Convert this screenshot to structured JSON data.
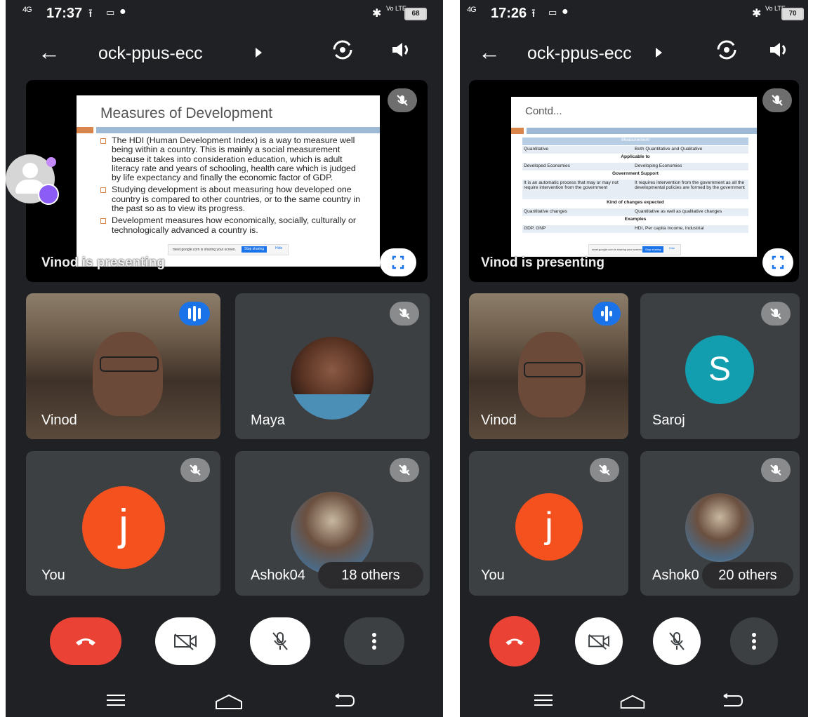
{
  "colors": {
    "background": "#202124",
    "tile": "#3c4043",
    "end_call": "#ea4335",
    "avatar_j": "#f4511e",
    "avatar_s": "#129eaf",
    "voice_indicator": "#1a73e8"
  },
  "left": {
    "status": {
      "network": "4G",
      "time": "17:37",
      "battery": "68",
      "lte": "Vo LTE"
    },
    "meeting_code": "ock-ppus-ecc",
    "presenting_label": "Vinod is presenting",
    "slide": {
      "title": "Measures of Development",
      "bullets": [
        "The HDI (Human Development Index) is a way to measure well being within a country. This is mainly a social measurement because it takes into consideration education, which is adult literacy rate and years of schooling, health care which is judged by life expectancy and finally the economic factor of GDP.",
        "Studying development  is about measuring how developed one country is compared to other countries, or to the same country in the past so as to view its progress.",
        "Development measures how economically,  socially, culturally or technologically advanced a country is."
      ],
      "share_text": "meet.google.com is sharing your screen.",
      "stop_sharing": "Stop sharing",
      "hide": "Hide"
    },
    "participants": [
      "Vinod",
      "Maya",
      "You",
      "Ashok04"
    ],
    "you_initial": "j",
    "others": "18 others"
  },
  "right": {
    "status": {
      "network": "4G",
      "time": "17:26",
      "battery": "70",
      "lte": "Vo LTE"
    },
    "meeting_code": "ock-ppus-ecc",
    "presenting_label": "Vinod is presenting",
    "slide": {
      "title": "Contd...",
      "table_header": "Measurement",
      "rows": [
        {
          "type": "cell",
          "left": "Quantitative",
          "right": "Both Quantitative and Qualitative"
        },
        {
          "type": "section",
          "text": "Applicable to"
        },
        {
          "type": "cell",
          "left": "Developed Economies",
          "right": "Developing Economies"
        },
        {
          "type": "section",
          "text": "Government Support"
        },
        {
          "type": "cell",
          "left": "It is an automatic process that may or may not require intervention from the government",
          "right": "It requires intervention from the government as all the developmental policies are formed by the government"
        },
        {
          "type": "section",
          "text": "Kind of changes expected"
        },
        {
          "type": "cell",
          "left": "Quantitative changes",
          "right": "Quantitative as well as qualitative changes"
        },
        {
          "type": "section",
          "text": "Examples"
        },
        {
          "type": "cell",
          "left": "GDP, GNP",
          "right": "HDI, Per capita Income, Industrial"
        }
      ],
      "share_text": "meet.google.com is sharing your screen.",
      "stop_sharing": "Stop sharing",
      "hide": "Hide"
    },
    "participants": [
      "Vinod",
      "Saroj",
      "You",
      "Ashok0"
    ],
    "saroj_initial": "S",
    "you_initial": "j",
    "others": "20 others"
  }
}
